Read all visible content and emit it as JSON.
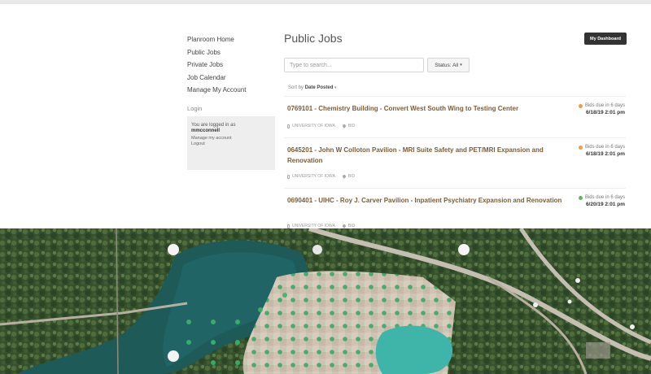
{
  "nav": {
    "items": [
      "Planroom Home",
      "Public Jobs",
      "Private Jobs",
      "Job Calendar",
      "Manage My Account"
    ]
  },
  "login": {
    "heading": "Login",
    "logged_in_text": "You are logged in as",
    "username": "mmcconnell",
    "manage_link": "Manage my account",
    "logout_link": "Logout"
  },
  "main": {
    "title": "Public Jobs",
    "dashboard_button": "My Dashboard",
    "search_placeholder": "Type to search...",
    "status_filter": "Status: All",
    "sort_prefix": "Sort by",
    "sort_value": "Date Posted"
  },
  "jobs": [
    {
      "title": "0769101 - Chemistry Building - Convert West South Wing to Testing Center",
      "owner": "UNIVERSITY OF IOWA",
      "type": "BID",
      "bids_due": "Bids due in 6 days",
      "date": "6/18/19 2:01 pm",
      "status_color": "#f0a030"
    },
    {
      "title": "0645201 - John W Colloton Pavilion - MRI Suite Safety and PET/MRI Expansion and Renovation",
      "owner": "UNIVERSITY OF IOWA",
      "type": "BID",
      "bids_due": "Bids due in 6 days",
      "date": "6/18/19 2:01 pm",
      "status_color": "#f0a030"
    },
    {
      "title": "0690401 - UIHC - Roy J. Carver Pavilion - Inpatient Psychiatry Expansion and Renovation",
      "owner": "UNIVERSITY OF IOWA",
      "type": "BID",
      "bids_due": "Bids due in 6 days",
      "date": "6/20/19 2:01 pm",
      "status_color": "#5cb85c"
    }
  ],
  "colors": {
    "job_title": "#7d5b37",
    "dashboard_button": "#333333"
  }
}
